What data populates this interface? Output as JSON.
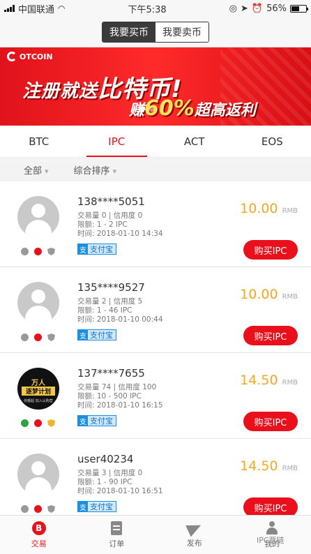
{
  "status_bar": {
    "carrier": "中国联通",
    "time": "下午5:38",
    "battery": "56%",
    "battery_level": 0.56
  },
  "header": {
    "buy_tab": "我要买币",
    "sell_tab": "我要卖币"
  },
  "banner": {
    "logo": "OTCOIN",
    "line1_a": "注册就送",
    "line1_b": "比特币!",
    "line2_a": "赚",
    "line2_b": "60%",
    "line2_c": "超高返利"
  },
  "coin_tabs": [
    "BTC",
    "IPC",
    "ACT",
    "EOS"
  ],
  "filters": {
    "all": "全部",
    "sort": "综合排序"
  },
  "listings": [
    {
      "name": "138****5051",
      "stats": "交易量 0 | 信用度 0",
      "limit": "限额: 1 - 2 IPC",
      "time": "时间: 2018-01-10 14:34",
      "pay": "支付宝",
      "price": "10.00",
      "unit": "RMB",
      "button": "购买IPC"
    },
    {
      "name": "135****9527",
      "stats": "交易量 2 | 信用度 5",
      "limit": "限额: 1 - 46 IPC",
      "time": "时间: 2018-01-10 00:44",
      "pay": "支付宝",
      "price": "10.00",
      "unit": "RMB",
      "button": "购买IPC"
    },
    {
      "name": "137****7655",
      "stats": "交易量 74 | 信用度 100",
      "limit": "限额: 10 - 500 IPC",
      "time": "时间: 2018-01-10 16:15",
      "pay": "支付宝",
      "price": "14.50",
      "unit": "RMB",
      "button": "购买IPC",
      "avatar": {
        "line1": "万人",
        "line2": "逐梦计划",
        "line3": "份额起 加入认购营"
      }
    },
    {
      "name": "user40234",
      "stats": "交易量 3 | 信用度 0",
      "limit": "限额: 1 - 90 IPC",
      "time": "时间: 2018-01-10 16:51",
      "pay": "支付宝",
      "price": "14.50",
      "unit": "RMB",
      "button": "购买IPC"
    }
  ],
  "bottom_nav": {
    "trade": "交易",
    "orders": "订单",
    "publish": "发布",
    "mine": "我的",
    "trade_icon": "B"
  },
  "watermark": "IPC票链"
}
